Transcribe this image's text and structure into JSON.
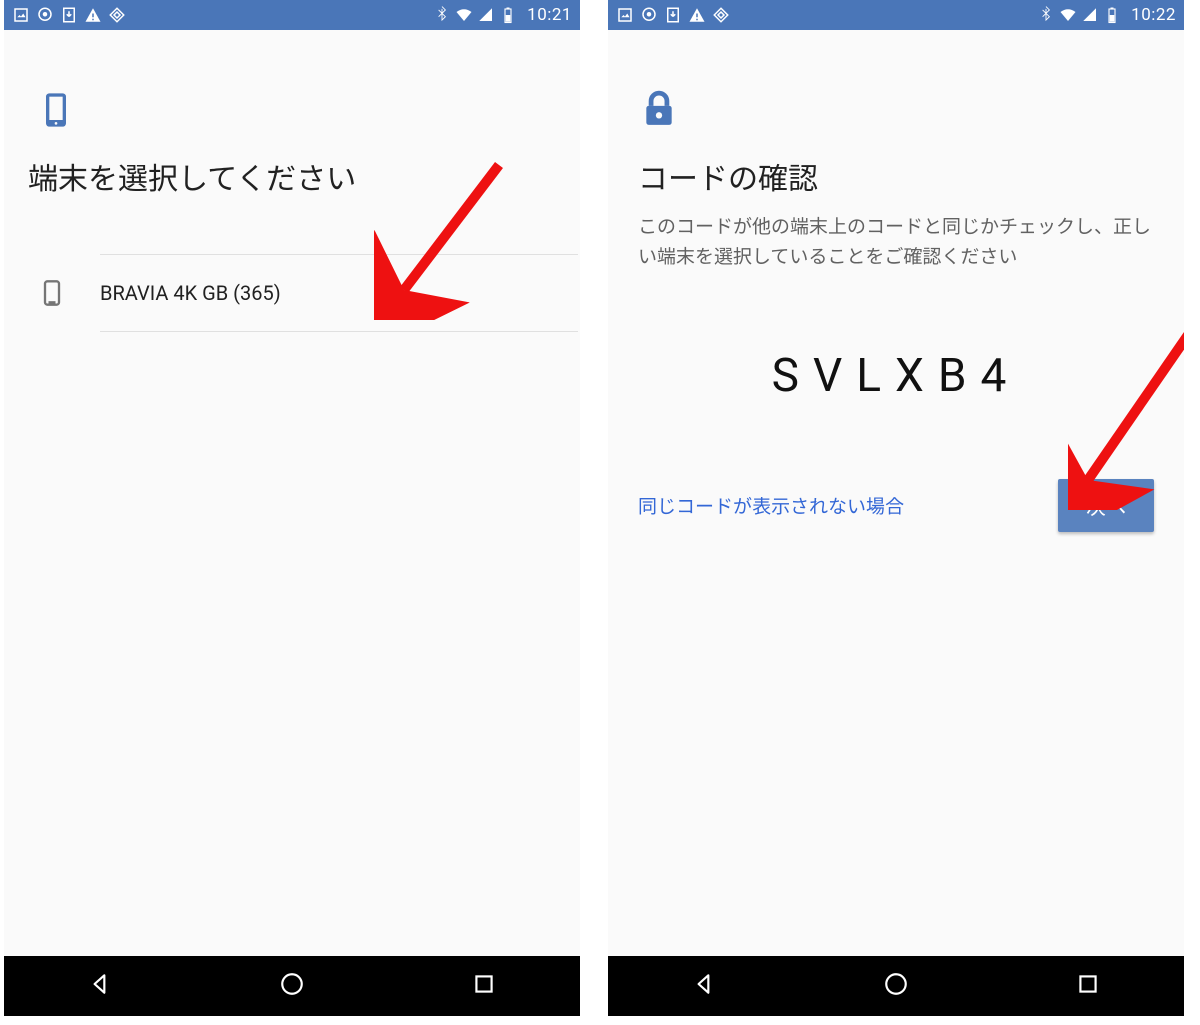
{
  "screen1": {
    "status": {
      "time": "10:21"
    },
    "title": "端末を選択してください",
    "devices": [
      {
        "name": "BRAVIA 4K GB (365)"
      }
    ]
  },
  "screen2": {
    "status": {
      "time": "10:22"
    },
    "title": "コードの確認",
    "description": "このコードが他の端末上のコードと同じかチェックし、正しい端末を選択していることをご確認ください",
    "code": "SVLXB4",
    "link_label": "同じコードが表示されない場合",
    "next_label": "次へ"
  }
}
